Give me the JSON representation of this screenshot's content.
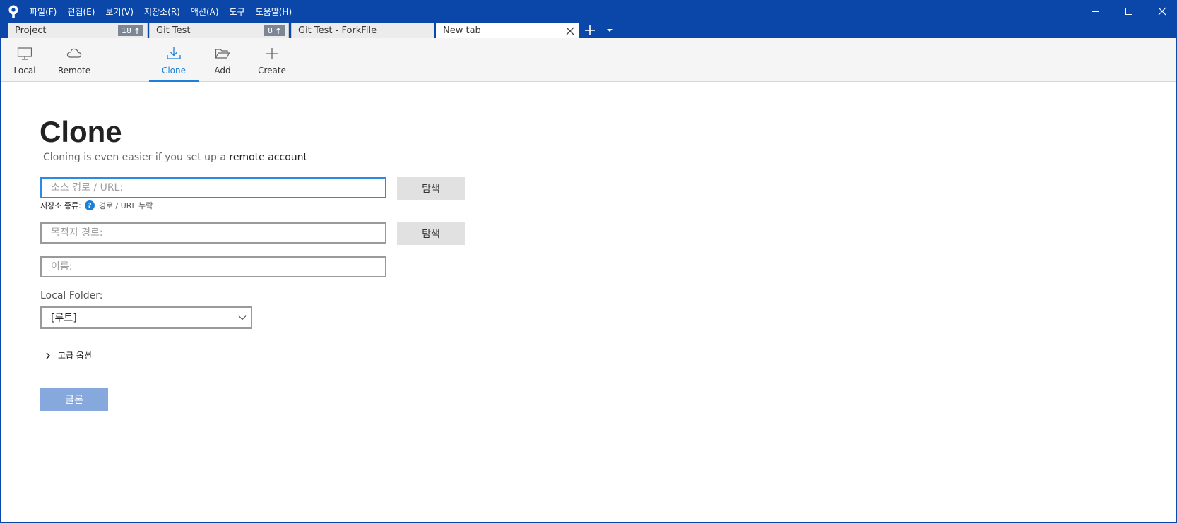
{
  "menu": [
    "파일(F)",
    "편집(E)",
    "보기(V)",
    "저장소(R)",
    "액션(A)",
    "도구",
    "도움말(H)"
  ],
  "tabs": [
    {
      "label": "Project",
      "badge": "18",
      "badge_icon": "arrow-up-icon"
    },
    {
      "label": "Git Test",
      "badge": "8",
      "badge_icon": "arrow-up-icon"
    },
    {
      "label": "Git Test - ForkFile"
    },
    {
      "label": "New tab",
      "active": true
    }
  ],
  "toolbar": {
    "local": "Local",
    "remote": "Remote",
    "clone": "Clone",
    "add": "Add",
    "create": "Create",
    "active": "clone"
  },
  "page": {
    "title": "Clone",
    "subtitle_text": "Cloning is even easier if you set up a",
    "subtitle_link": "remote account"
  },
  "form": {
    "source_placeholder": "소스 경로 / URL:",
    "browse_label": "탐색",
    "repo_type_label": "저장소 종류:",
    "repo_type_help": "?",
    "repo_type_value": "경로 / URL 누락",
    "dest_placeholder": "목적지 경로:",
    "name_placeholder": "이름:",
    "local_folder_label": "Local Folder:",
    "local_folder_value": "[루트]",
    "advanced_label": "고급 옵션",
    "clone_button": "클론"
  },
  "colors": {
    "titlebar": "#0a47a8",
    "accent": "#1e7fd8",
    "clone_button": "#86a8dc"
  }
}
